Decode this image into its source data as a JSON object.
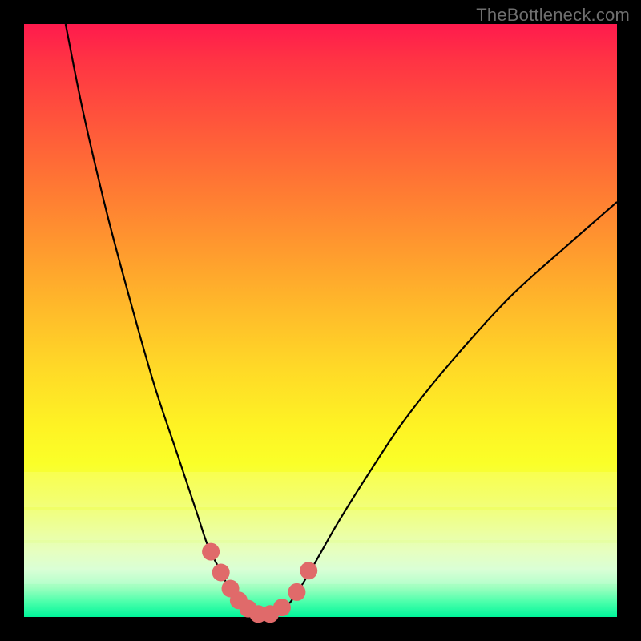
{
  "watermark": "TheBottleneck.com",
  "colors": {
    "frame_bg": "#000000",
    "curve_stroke": "#000000",
    "marker_fill": "#e06a6a",
    "marker_stroke": "#c74f4f"
  },
  "chart_data": {
    "type": "line",
    "title": "",
    "xlabel": "",
    "ylabel": "",
    "xlim": [
      0,
      100
    ],
    "ylim": [
      0,
      100
    ],
    "series": [
      {
        "name": "left-branch",
        "x": [
          7,
          10,
          14,
          18,
          22,
          26,
          29,
          31,
          33,
          34.5,
          36,
          37.5,
          39
        ],
        "y": [
          100,
          85,
          68,
          53,
          39,
          27,
          18,
          12,
          8,
          5,
          2.5,
          1,
          0.3
        ]
      },
      {
        "name": "right-branch",
        "x": [
          42,
          44,
          46,
          49,
          53,
          58,
          64,
          72,
          82,
          92,
          100
        ],
        "y": [
          0.3,
          1.5,
          4,
          9,
          16,
          24,
          33,
          43,
          54,
          63,
          70
        ]
      },
      {
        "name": "valley-floor",
        "x": [
          39,
          40,
          41,
          42
        ],
        "y": [
          0.3,
          0.2,
          0.2,
          0.3
        ]
      }
    ],
    "markers": {
      "name": "highlighted-points",
      "x": [
        31.5,
        33.2,
        34.8,
        36.2,
        37.8,
        39.5,
        41.5,
        43.5,
        46.0,
        48.0
      ],
      "y": [
        11.0,
        7.5,
        4.8,
        2.8,
        1.4,
        0.5,
        0.5,
        1.6,
        4.2,
        7.8
      ]
    }
  }
}
